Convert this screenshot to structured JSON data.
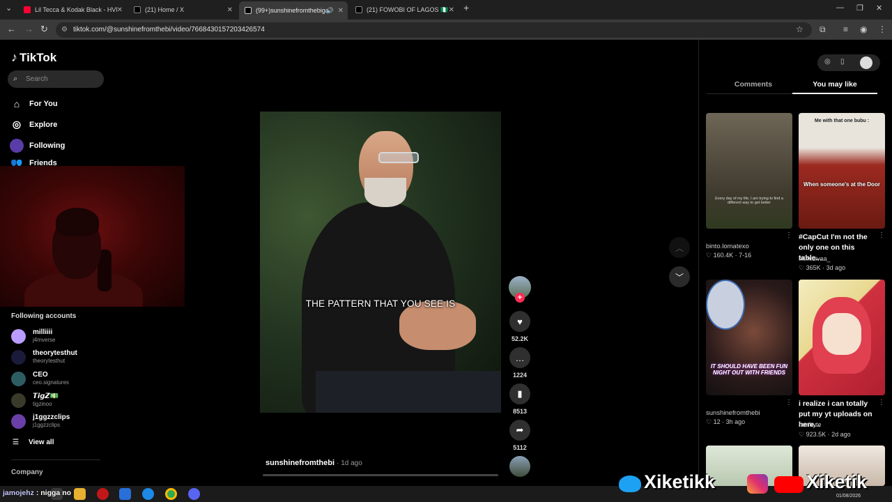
{
  "browser": {
    "tabs": [
      {
        "title": "Lil Tecca & Kodak Black - HVN I...",
        "color": "#ff0033"
      },
      {
        "title": "(21) Home / X",
        "color": "#ffffff"
      },
      {
        "title": "(99+)sunshinefromthebigap...",
        "color": "#ffffff"
      },
      {
        "title": "(21) FOWOBI OF LAGOS 🇳🇬 on X...",
        "color": "#ffffff"
      }
    ],
    "new_tab": "+",
    "url": "tiktok.com/@sunshinefromthebi/video/7668430157203426574"
  },
  "sidebar": {
    "logo": "TikTok",
    "search_placeholder": "Search",
    "nav": [
      {
        "label": "For You",
        "icon": "home-icon"
      },
      {
        "label": "Explore",
        "icon": "compass-icon"
      },
      {
        "label": "Following",
        "icon": "following-icon"
      },
      {
        "label": "Friends",
        "icon": "friends-icon"
      }
    ],
    "following_title": "Following accounts",
    "accounts": [
      {
        "name": "milliiii",
        "handle": "j4mverse",
        "color": "#b99cff"
      },
      {
        "name": "theorytesthut",
        "handle": "theorytesthut",
        "color": "#1a1a3a"
      },
      {
        "name": "CEO",
        "handle": "ceo.signatures",
        "color": "#2e5c63"
      },
      {
        "name": "𝙏𝙞𝙜𝙕💵",
        "handle": "tigzinoo",
        "color": "#3a3a2a"
      },
      {
        "name": "j1ggzzclips",
        "handle": "j1ggzzclips",
        "color": "#6b3fa8"
      }
    ],
    "view_all": "View all",
    "company": "Company"
  },
  "video": {
    "caption": "THE PATTERN THAT YOU SEE IS",
    "author": "sunshinefromthebi",
    "ago": "1d ago",
    "likes": "52.2K",
    "comments": "1224",
    "saves": "8513",
    "shares": "5112"
  },
  "right_panel": {
    "tabs": [
      "Comments",
      "You may like"
    ],
    "active_tab": "You may like",
    "cards": [
      {
        "title": "binto.lomatexo",
        "user": "",
        "stat": "160.4K · 7-16",
        "overlay": "Every day of my life, I am trying to find a different way to get better",
        "bg": "#5a5446"
      },
      {
        "title": "#CapCut I'm not the only one on this table...",
        "user": "mimidivaa_",
        "stat": "365K · 3d ago",
        "overlay": "When someone's at the Door",
        "top_overlay": "Me with that one bubu :",
        "bg": "#8c2a22"
      },
      {
        "title": "sunshinefromthebi",
        "user": "",
        "stat": "12 · 3h ago",
        "overlay": "IT SHOULD HAVE BEEN FUN NIGHT OUT WITH FRIENDS",
        "bg": "#2a1c1c"
      },
      {
        "title": "i realize i can totally put my yt uploads on here...",
        "user": "rambyte",
        "stat": "923.5K · 2d ago",
        "overlay": "",
        "bg": "#d8d2a8"
      }
    ]
  },
  "taskbar": {
    "chat_user": "jamojehz",
    "chat_message": ": nigga no",
    "date": "01/08/2026"
  },
  "branding": {
    "left": "Xiketikk",
    "right": "Xiketik"
  }
}
